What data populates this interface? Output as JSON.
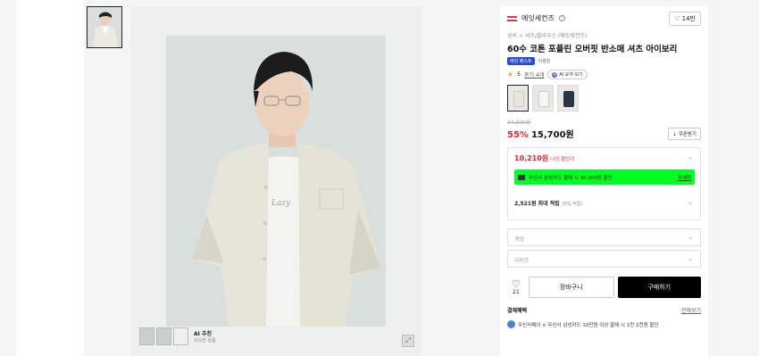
{
  "brand": {
    "name": "에잇세컨즈",
    "like_count": "14만"
  },
  "breadcrumb": "상의 > 셔츠/블라우스 (에잇세컨즈)",
  "product": {
    "title": "60수 코튼 포플린 오버핏 반소매 셔츠 아이보리",
    "tag_blue": "에잇 베스트",
    "tag_gray": "이월된",
    "rating": "5",
    "review_label": "후기 4개",
    "ai_summary_label": "AI 요약 보기"
  },
  "pricing": {
    "original": "34,900원",
    "discount": "55%",
    "price": "15,700원",
    "coupon_label": "쿠폰받기",
    "my_price": "10,210원",
    "my_price_label": "나의 할인가",
    "card_promo": "무신사 삼성카드 결제 시 30,000원 할인",
    "card_detail": "자세히",
    "points": "2,521원 최대 적립",
    "points_sub": "(5% 적립)"
  },
  "options": {
    "color_placeholder": "색상",
    "size_placeholder": "사이즈"
  },
  "actions": {
    "like_count": "21",
    "cart_label": "장바구니",
    "buy_label": "구매하기"
  },
  "payment": {
    "title": "결제혜택",
    "all_label": "전체보기",
    "item": "무신사페이 × 무신사 삼성카드 10만원 이상 결제 시 1만 2천원 할인"
  },
  "gallery": {
    "ai_title": "AI 추천",
    "ai_sub": "비슷한 상품"
  },
  "icons": [
    "heart-icon",
    "info-icon",
    "star-icon",
    "chevron-down-icon",
    "expand-icon",
    "card-icon"
  ]
}
